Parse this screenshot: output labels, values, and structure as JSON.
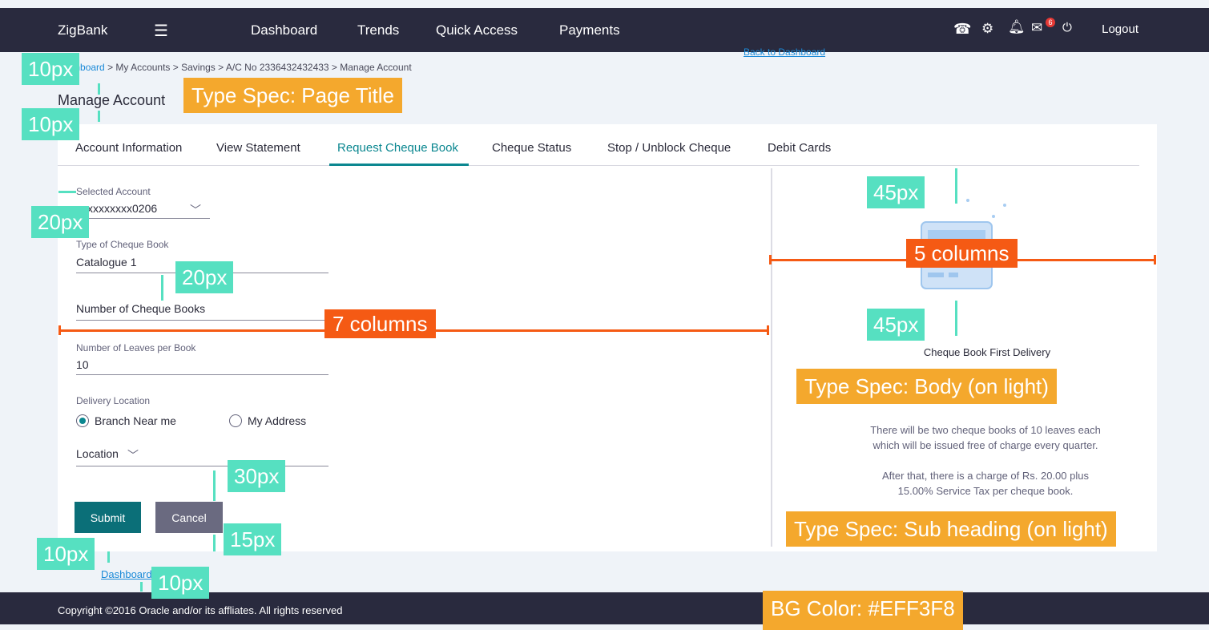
{
  "header": {
    "brand": "ZigBank",
    "menu_icon": "hamburger-icon",
    "nav": [
      "Dashboard",
      "Trends",
      "Quick Access",
      "Payments"
    ],
    "notification_count": "6",
    "logout": "Logout"
  },
  "breadcrumb": {
    "home": "Dashboard",
    "trail": "> My Accounts  > Savings > A/C No 2336432432433 > Manage Account"
  },
  "back_to_dashboard_top": "Back to Dashboard",
  "page_title": "Manage Account",
  "tabs": [
    "Account Information",
    "View Statement",
    "Request Cheque Book",
    "Cheque Status",
    "Stop / Unblock Cheque",
    "Debit Cards"
  ],
  "form": {
    "selected_account_label": "Selected Account",
    "selected_account_value": "xxxxxxxxxx0206",
    "cheque_book_type_label": "Type of Cheque Book",
    "cheque_book_type_value": "Catalogue 1",
    "num_books_label": "Number of Cheque Books",
    "leaves_label": "Number of Leaves per Book",
    "leaves_value": "10",
    "delivery_label": "Delivery Location",
    "radio_branch": "Branch Near me",
    "radio_address": "My Address",
    "location_label": "Location",
    "submit": "Submit",
    "cancel": "Cancel"
  },
  "back_to_dashboard_bottom": "Dashboard",
  "right_panel": {
    "title": "Cheque Book First Delivery",
    "para1_line1": "There will be two cheque books of 10 leaves each",
    "para1_line2": "which will be issued free of charge every quarter.",
    "para2_line1": "After that, there is a charge of Rs. 20.00 plus",
    "para2_line2": "15.00% Service Tax per cheque book."
  },
  "footer": "Copyright ©2016 Oracle and/or its affliates. All rights reserved",
  "annotations": {
    "a10_1": "10px",
    "a10_2": "10px",
    "a20_1": "20px",
    "a20_2": "20px",
    "a45_1": "45px",
    "a45_2": "45px",
    "a30": "30px",
    "a15": "15px",
    "a10_3": "10px",
    "a10_4": "10px",
    "type_page_title": "Type Spec: Page Title",
    "type_body": "Type Spec: Body (on light)",
    "type_sub": "Type Spec: Sub heading (on light)",
    "bg_color": "BG Color: #EFF3F8",
    "cols_5": "5 columns",
    "cols_7": "7 columns"
  }
}
